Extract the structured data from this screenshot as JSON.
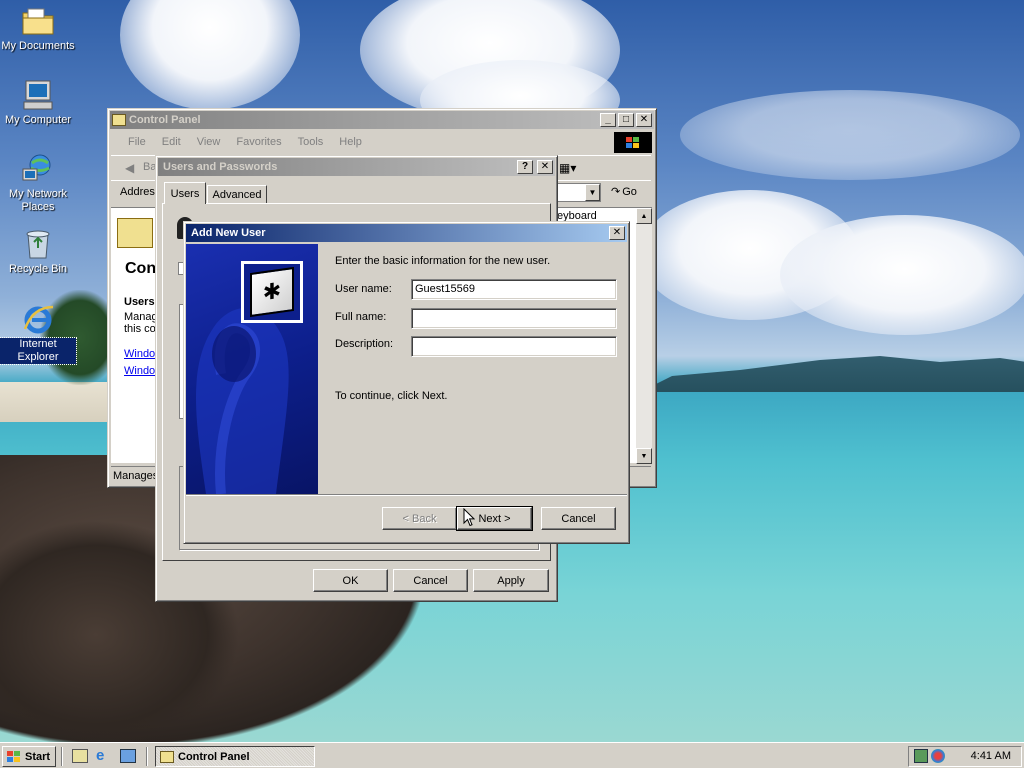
{
  "desktop": {
    "icons": [
      {
        "label": "My Documents",
        "icon": "folder-icon"
      },
      {
        "label": "My Computer",
        "icon": "computer-icon"
      },
      {
        "label": "My Network Places",
        "icon": "network-icon"
      },
      {
        "label": "Recycle Bin",
        "icon": "recycle-bin-icon"
      },
      {
        "label": "Internet Explorer",
        "icon": "ie-icon"
      }
    ]
  },
  "control_panel": {
    "title": "Control Panel",
    "menu": [
      "File",
      "Edit",
      "View",
      "Favorites",
      "Tools",
      "Help"
    ],
    "back_label": "Ba",
    "address_label": "Addres",
    "go_label": "Go",
    "list_item_partial": "eyboard",
    "left_heading": "Con",
    "left_subheading": "Users",
    "left_text_1": "Manag",
    "left_text_2": "this co",
    "left_link_1": "Windo",
    "left_link_2": "Windo",
    "status_text": "Manages"
  },
  "users_passwords": {
    "title": "Users and Passwords",
    "tabs": [
      "Users",
      "Advanced"
    ],
    "ok_label": "OK",
    "cancel_label": "Cancel",
    "apply_label": "Apply"
  },
  "add_user_dialog": {
    "title": "Add New User",
    "intro": "Enter the basic information for the new user.",
    "username_label": "User name:",
    "username_value": "Guest15569",
    "fullname_label": "Full name:",
    "fullname_value": "",
    "description_label": "Description:",
    "description_value": "",
    "continue_text": "To continue, click Next.",
    "back_label": "< Back",
    "next_label": "Next >",
    "cancel_label": "Cancel"
  },
  "taskbar": {
    "start_label": "Start",
    "task_label": "Control Panel",
    "clock": "4:41 AM"
  },
  "colors": {
    "titlebar_active": "#0a246a",
    "titlebar_inactive": "#808080",
    "face": "#d4d0c8",
    "wizard_banner": "#0d1f8c"
  }
}
